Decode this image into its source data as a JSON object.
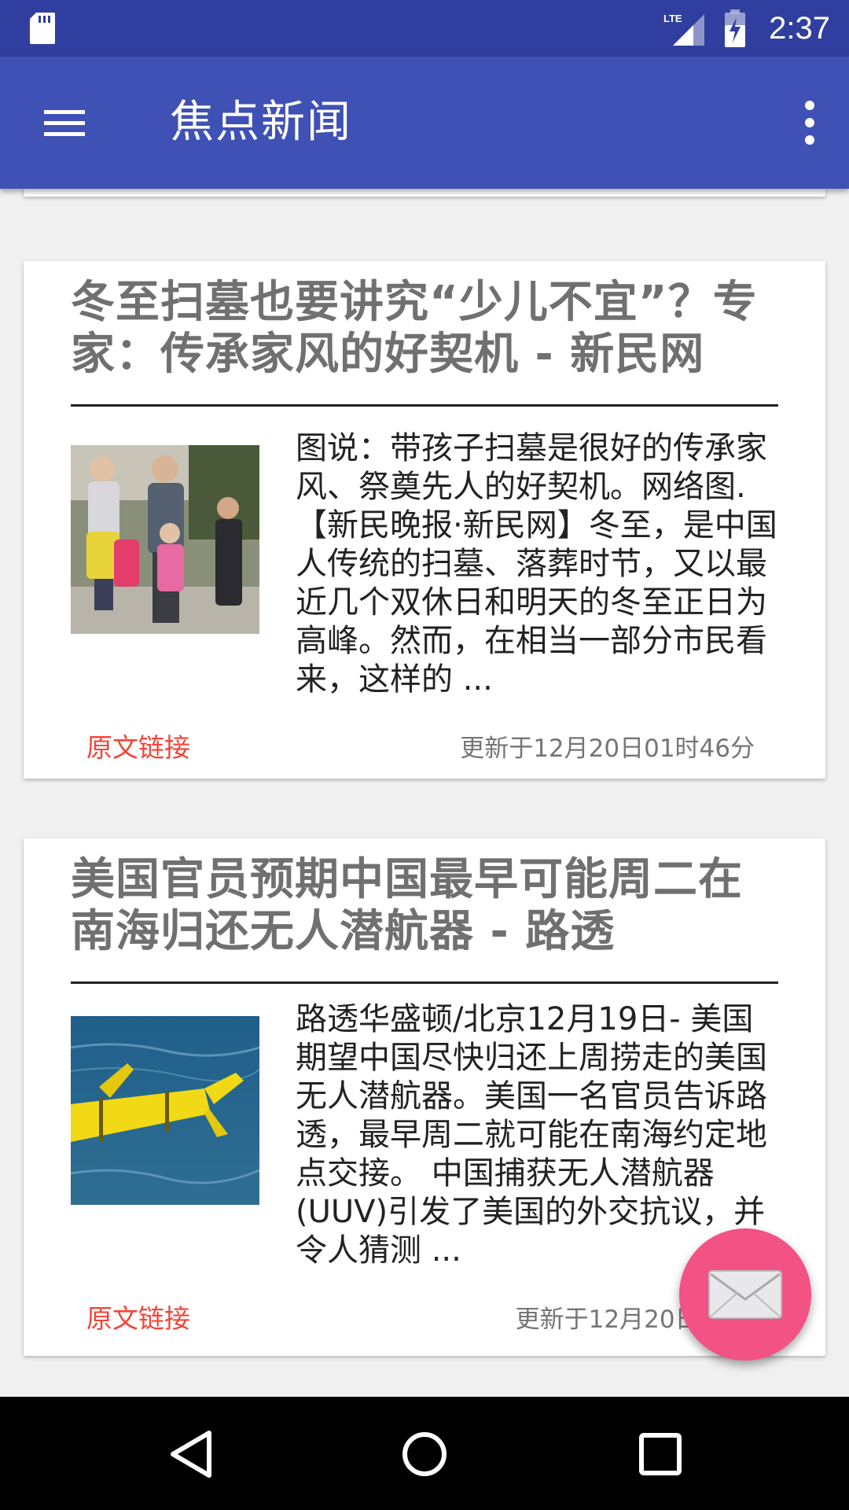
{
  "status_bar": {
    "time": "2:37",
    "network_label": "LTE",
    "icons": [
      "sd-card-icon",
      "lte-signal-icon",
      "battery-charging-icon"
    ]
  },
  "app_bar": {
    "title": "焦点新闻",
    "icons": [
      "menu-icon",
      "more-vert-icon"
    ]
  },
  "news": [
    {
      "title": "冬至扫墓也要讲究“少儿不宜”？专家：传承家风的好契机 - 新民网",
      "summary": "图说：带孩子扫墓是很好的传承家风、祭奠先人的好契机。网络图. 【新民晚报·新民网】冬至，是中国人传统的扫墓、落葬时节，又以最近几个双休日和明天的冬至正日为高峰。然而，在相当一部分市民看来，这样的 ...",
      "link_label": "原文链接",
      "updated": "更新于12月20日01时46分",
      "image": "family-photo"
    },
    {
      "title": "美国官员预期中国最早可能周二在南海归还无人潜航器 - 路透",
      "summary": "路透华盛顿/北京12月19日- 美国期望中国尽快归还上周捞走的美国无人潜航器。美国一名官员告诉路透，最早周二就可能在南海约定地点交接。 中国捕获无人潜航器(UUV)引发了美国的外交抗议，并令人猜测 ...",
      "link_label": "原文链接",
      "updated": "更新于12月20日01时",
      "image": "underwater-drone-photo"
    }
  ],
  "fab": {
    "icon": "mail-icon"
  },
  "nav_bar": {
    "icons": [
      "back-icon",
      "home-icon",
      "recent-apps-icon"
    ]
  },
  "colors": {
    "status_bar": "#303f9f",
    "app_bar": "#3f51b5",
    "fab": "#f25284",
    "link": "#f44336",
    "title_text": "#707070"
  }
}
